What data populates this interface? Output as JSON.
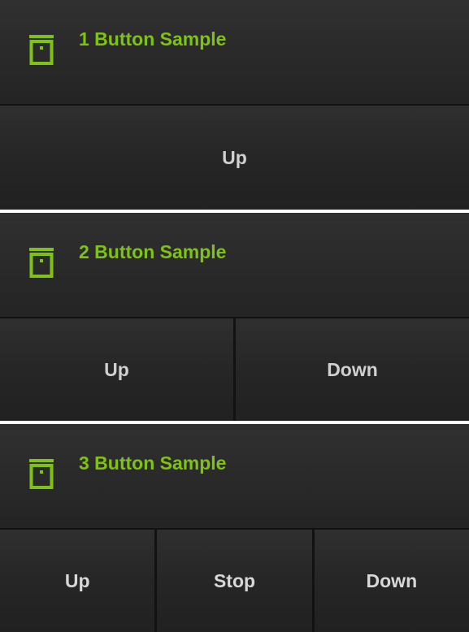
{
  "colors": {
    "accent": "#7ec313",
    "panel_bg": "#242424",
    "button_text": "#d0d0d0",
    "divider": "#ffffff"
  },
  "icon": "shutter-icon",
  "panels": [
    {
      "title": "1 Button Sample",
      "buttons": [
        "Up"
      ]
    },
    {
      "title": "2 Button Sample",
      "buttons": [
        "Up",
        "Down"
      ]
    },
    {
      "title": "3 Button Sample",
      "buttons": [
        "Up",
        "Stop",
        "Down"
      ]
    }
  ]
}
